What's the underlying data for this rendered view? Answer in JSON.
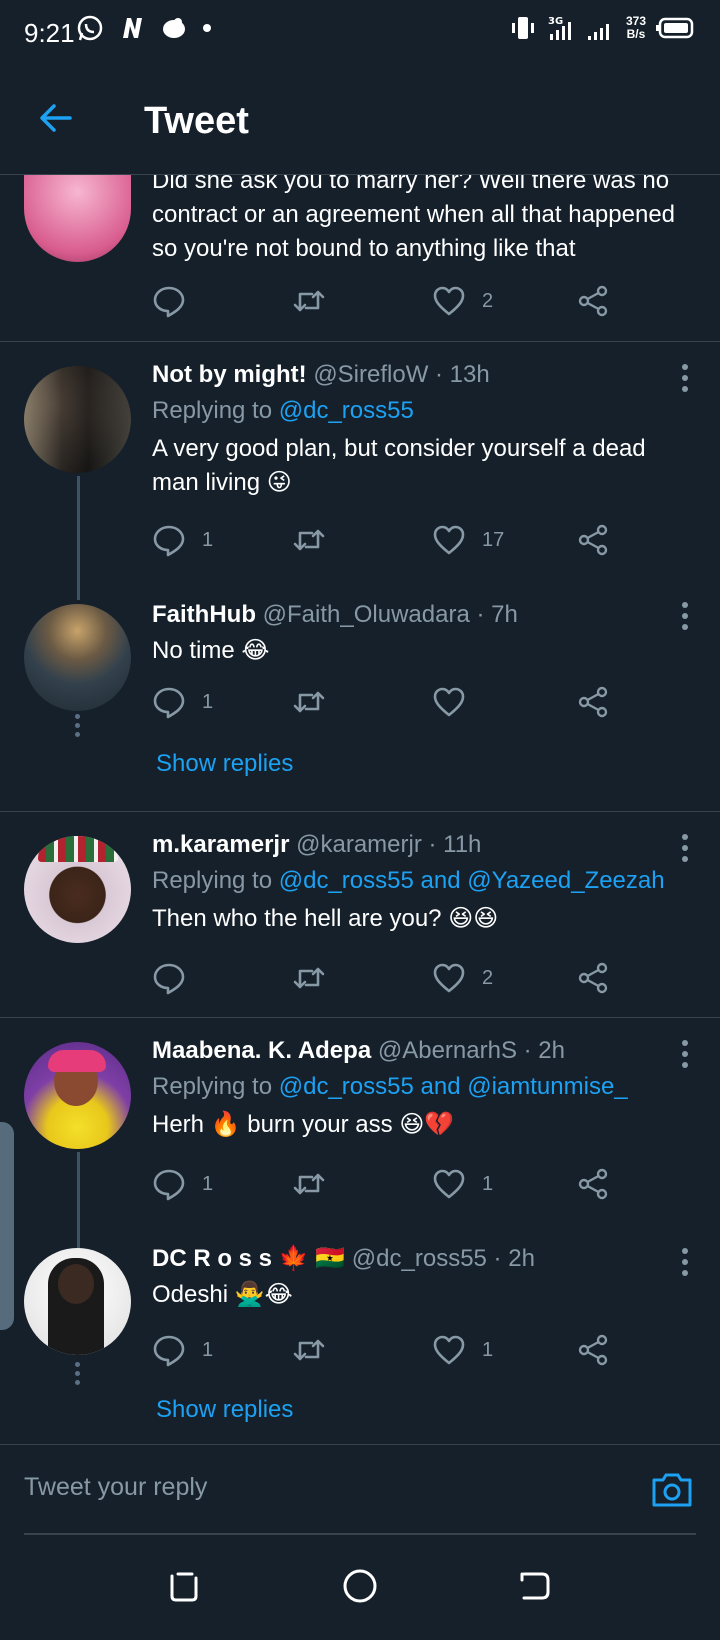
{
  "status": {
    "time": "9:21",
    "net_top": "373",
    "net_bottom": "B/s",
    "signal": "3G"
  },
  "header": {
    "title": "Tweet"
  },
  "top_partial": {
    "text": "Did she ask you to marry her? Well there was no contract or an agreement when all that happened so you're not bound to anything like that",
    "likes": "2"
  },
  "tweets": [
    {
      "name": "Not by might!",
      "meta": "@SirefloW · 13h",
      "replying_prefix": "Replying to ",
      "replying_to": "@dc_ross55",
      "text": "A very good plan, but consider yourself a dead man living 😜",
      "replies": "1",
      "likes": "17"
    },
    {
      "name": "FaithHub",
      "meta": "@Faith_Oluwadara · 7h",
      "text": "No time 😂",
      "replies": "1",
      "likes": ""
    },
    {
      "name": "m.karamerjr",
      "meta": "@karamerjr · 11h",
      "replying_prefix": "Replying to ",
      "replying_to": "@dc_ross55 and @Yazeed_Zeezah",
      "text": "Then who the hell are you? 😆😆",
      "replies": "",
      "likes": "2"
    },
    {
      "name": "Maabena. K. Adepa",
      "meta": "@AbernarhS · 2h",
      "replying_prefix": "Replying to ",
      "replying_to": "@dc_ross55 and @iamtunmise_",
      "text": "Herh  🔥 burn your ass 😆💔",
      "replies": "1",
      "likes": "1"
    },
    {
      "name": "DC R o s s 🍁 🇬🇭",
      "meta": "@dc_ross55 · 2h",
      "text": "Odeshi 🙅‍♂️😂",
      "replies": "1",
      "likes": "1"
    }
  ],
  "show_replies_label": "Show replies",
  "reply_bar": {
    "placeholder": "Tweet your reply"
  },
  "colors": {
    "background": "#15202b",
    "accent": "#1da1f2",
    "muted": "#8899a6",
    "divider": "#38444d"
  }
}
